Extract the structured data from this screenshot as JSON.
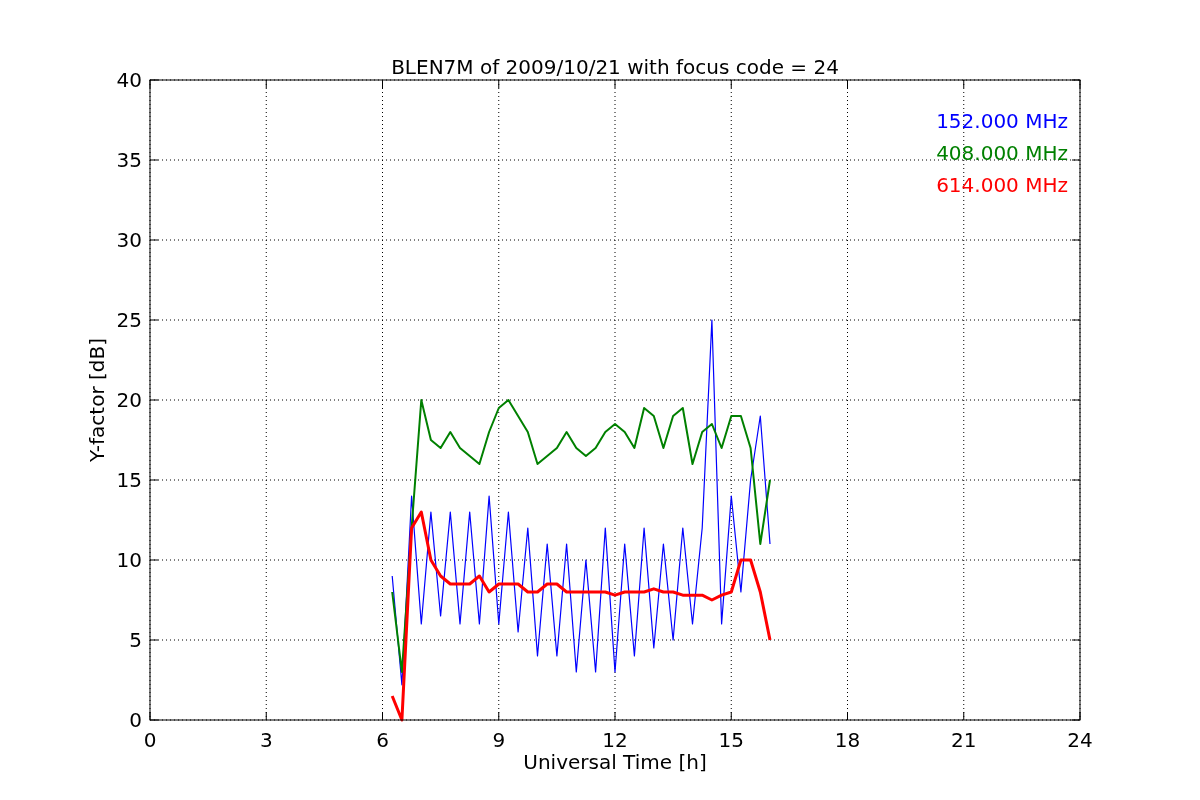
{
  "chart_data": {
    "type": "line",
    "title": "BLEN7M of 2009/10/21 with focus code = 24",
    "xlabel": "Universal Time [h]",
    "ylabel": "Y-factor [dB]",
    "xlim": [
      0,
      24
    ],
    "ylim": [
      0,
      40
    ],
    "xticks": [
      0,
      3,
      6,
      9,
      12,
      15,
      18,
      21,
      24
    ],
    "yticks": [
      0,
      5,
      10,
      15,
      20,
      25,
      30,
      35,
      40
    ],
    "grid": true,
    "x": [
      6.25,
      6.5,
      6.75,
      7.0,
      7.25,
      7.5,
      7.75,
      8.0,
      8.25,
      8.5,
      8.75,
      9.0,
      9.25,
      9.5,
      9.75,
      10.0,
      10.25,
      10.5,
      10.75,
      11.0,
      11.25,
      11.5,
      11.75,
      12.0,
      12.25,
      12.5,
      12.75,
      13.0,
      13.25,
      13.5,
      13.75,
      14.0,
      14.25,
      14.5,
      14.75,
      15.0,
      15.25,
      15.5,
      15.75,
      16.0
    ],
    "series": [
      {
        "name": "152.000 MHz",
        "color": "#0000ff",
        "values": [
          9,
          2.2,
          14,
          6,
          13,
          6.5,
          13,
          6,
          13,
          6,
          14,
          6,
          13,
          5.5,
          12,
          4,
          11,
          4,
          11,
          3,
          10,
          3,
          12,
          3,
          11,
          4,
          12,
          4.5,
          11,
          5,
          12,
          6,
          12,
          25,
          6,
          14,
          8,
          15,
          19,
          11
        ]
      },
      {
        "name": "408.000 MHz",
        "color": "#008000",
        "values": [
          8,
          3,
          12,
          20,
          17.5,
          17,
          18,
          17,
          16.5,
          16,
          18,
          19.5,
          20,
          19,
          18,
          16,
          16.5,
          17,
          18,
          17,
          16.5,
          17,
          18,
          18.5,
          18,
          17,
          19.5,
          19,
          17,
          19,
          19.5,
          16,
          18,
          18.5,
          17,
          19,
          19,
          17,
          11,
          15
        ]
      },
      {
        "name": "614.000 MHz",
        "color": "#ff0000",
        "values": [
          1.5,
          0,
          12,
          13,
          10,
          9,
          8.5,
          8.5,
          8.5,
          9,
          8,
          8.5,
          8.5,
          8.5,
          8,
          8,
          8.5,
          8.5,
          8,
          8,
          8,
          8,
          8,
          7.8,
          8,
          8,
          8,
          8.2,
          8,
          8,
          7.8,
          7.8,
          7.8,
          7.5,
          7.8,
          8,
          10,
          10,
          8,
          5
        ]
      }
    ]
  }
}
